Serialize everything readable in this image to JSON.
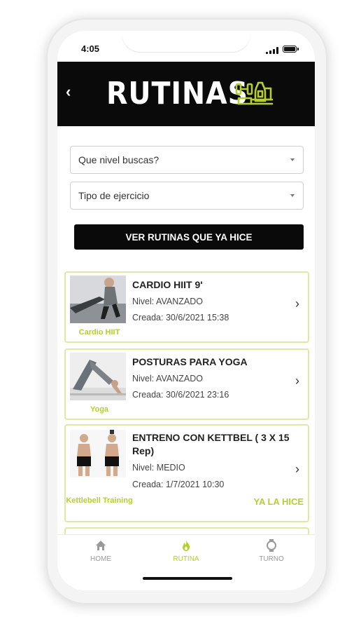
{
  "status": {
    "time": "4:05"
  },
  "header": {
    "back_label": "‹",
    "title": "RUTINAS"
  },
  "filters": {
    "level_placeholder": "Que nivel buscas?",
    "type_placeholder": "Tipo de ejercicio"
  },
  "done_button_label": "VER RUTINAS QUE YA HICE",
  "routines": [
    {
      "title": "CARDIO HIIT 9'",
      "level": "Nivel: AVANZADO",
      "created": "Creada: 30/6/2021 15:38",
      "thumb_label": "Cardio HIIT",
      "done": ""
    },
    {
      "title": "POSTURAS PARA YOGA",
      "level": "Nivel: AVANZADO",
      "created": "Creada: 30/6/2021 23:16",
      "thumb_label": "Yoga",
      "done": ""
    },
    {
      "title": "ENTRENO CON KETTBEL ( 3 X 15 Rep)",
      "level": "Nivel: MEDIO",
      "created": "Creada: 1/7/2021 10:30",
      "thumb_label": "Kettlebell Training",
      "done": "YA LA HICE"
    }
  ],
  "tabs": [
    {
      "label": "HOME",
      "icon": "home-icon"
    },
    {
      "label": "RUTINA",
      "icon": "flame-icon"
    },
    {
      "label": "TURNO",
      "icon": "watch-icon"
    }
  ],
  "colors": {
    "accent": "#b6cf2c",
    "header_bg": "#0a0a0a",
    "card_border": "#dfe9a6"
  }
}
